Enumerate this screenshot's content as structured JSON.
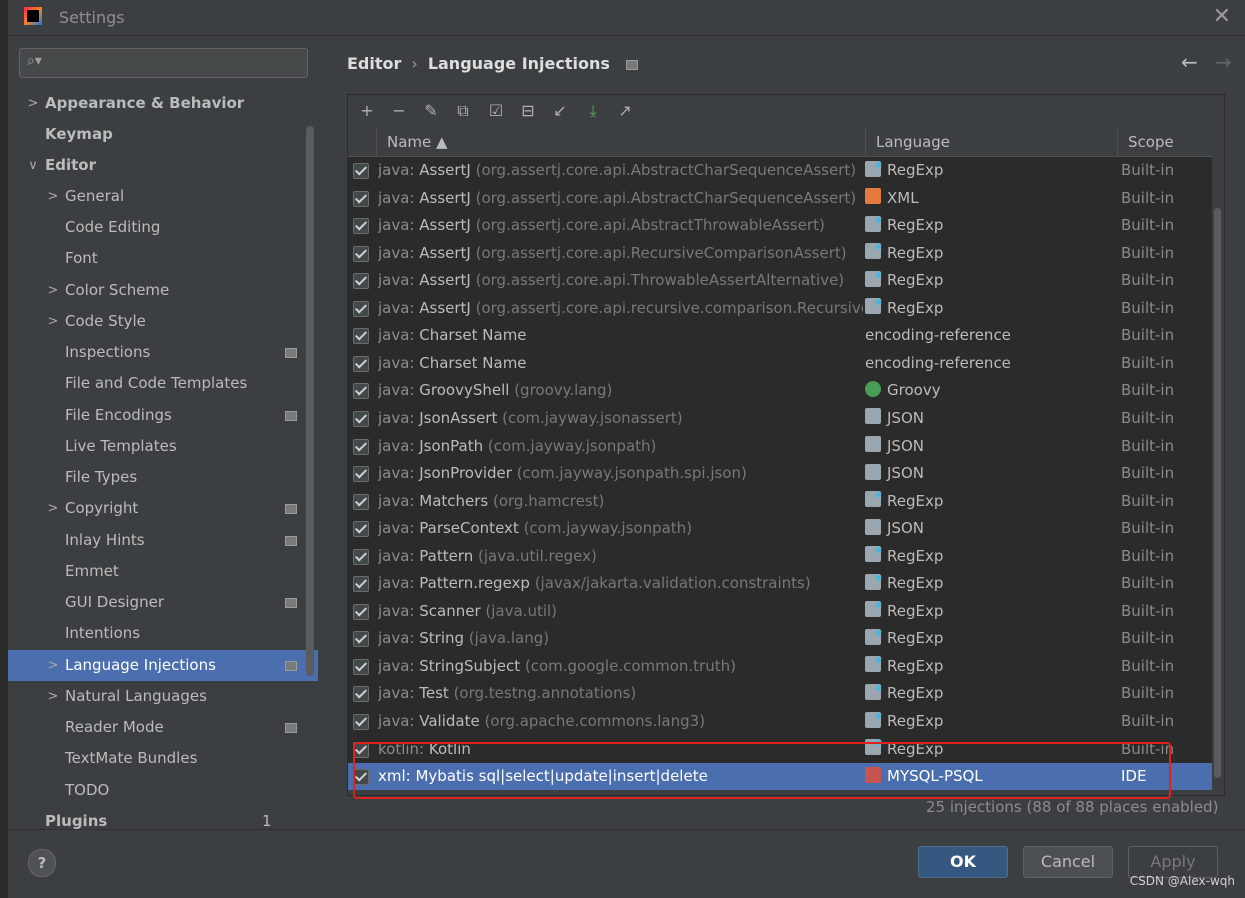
{
  "window": {
    "title": "Settings"
  },
  "search": {
    "placeholder": ""
  },
  "sidebar": {
    "items": [
      {
        "label": "Appearance & Behavior",
        "arrow": ">",
        "bold": true
      },
      {
        "label": "Keymap",
        "bold": true
      },
      {
        "label": "Editor",
        "arrow": "∨",
        "bold": true
      },
      {
        "label": "General",
        "arrow": ">"
      },
      {
        "label": "Code Editing"
      },
      {
        "label": "Font"
      },
      {
        "label": "Color Scheme",
        "arrow": ">"
      },
      {
        "label": "Code Style",
        "arrow": ">"
      },
      {
        "label": "Inspections",
        "proj": true
      },
      {
        "label": "File and Code Templates"
      },
      {
        "label": "File Encodings",
        "proj": true
      },
      {
        "label": "Live Templates"
      },
      {
        "label": "File Types"
      },
      {
        "label": "Copyright",
        "arrow": ">",
        "proj": true
      },
      {
        "label": "Inlay Hints",
        "proj": true
      },
      {
        "label": "Emmet"
      },
      {
        "label": "GUI Designer",
        "proj": true
      },
      {
        "label": "Intentions"
      },
      {
        "label": "Language Injections",
        "arrow": ">",
        "proj": true,
        "selected": true
      },
      {
        "label": "Natural Languages",
        "arrow": ">"
      },
      {
        "label": "Reader Mode",
        "proj": true
      },
      {
        "label": "TextMate Bundles"
      },
      {
        "label": "TODO"
      },
      {
        "label": "Plugins",
        "bold": true,
        "count": "1"
      }
    ]
  },
  "breadcrumb": {
    "parent": "Editor",
    "separator": "›",
    "current": "Language Injections"
  },
  "nav": {
    "back": "←",
    "forward": "→"
  },
  "toolbar": {
    "icons": [
      "add-icon",
      "remove-icon",
      "edit-icon",
      "copy-icon",
      "enable-icon",
      "disable-icon",
      "import-icon",
      "download-icon",
      "export-icon"
    ],
    "glyphs": [
      "+",
      "−",
      "✎",
      "⧉",
      "☑",
      "⊟",
      "↙",
      "⤓",
      "↗"
    ]
  },
  "table": {
    "headers": {
      "name": "Name ▲",
      "language": "Language",
      "scope": "Scope"
    },
    "rows": [
      {
        "pfx": "java: ",
        "id": "AssertJ",
        "pkg": " (org.assertj.core.api.AbstractCharSequenceAssert)",
        "lang": "RegExp",
        "icon": "regexp",
        "scope": "Built-in"
      },
      {
        "pfx": "java: ",
        "id": "AssertJ",
        "pkg": " (org.assertj.core.api.AbstractCharSequenceAssert)",
        "lang": "XML",
        "icon": "xml",
        "scope": "Built-in"
      },
      {
        "pfx": "java: ",
        "id": "AssertJ",
        "pkg": " (org.assertj.core.api.AbstractThrowableAssert)",
        "lang": "RegExp",
        "icon": "regexp",
        "scope": "Built-in"
      },
      {
        "pfx": "java: ",
        "id": "AssertJ",
        "pkg": " (org.assertj.core.api.RecursiveComparisonAssert)",
        "lang": "RegExp",
        "icon": "regexp",
        "scope": "Built-in"
      },
      {
        "pfx": "java: ",
        "id": "AssertJ",
        "pkg": " (org.assertj.core.api.ThrowableAssertAlternative)",
        "lang": "RegExp",
        "icon": "regexp",
        "scope": "Built-in"
      },
      {
        "pfx": "java: ",
        "id": "AssertJ",
        "pkg": " (org.assertj.core.api.recursive.comparison.RecursiveCo",
        "lang": "RegExp",
        "icon": "regexp",
        "scope": "Built-in"
      },
      {
        "pfx": "java: ",
        "id": "Charset Name",
        "pkg": "",
        "lang": "encoding-reference",
        "icon": "",
        "scope": "Built-in"
      },
      {
        "pfx": "java: ",
        "id": "Charset Name",
        "pkg": "",
        "lang": "encoding-reference",
        "icon": "",
        "scope": "Built-in"
      },
      {
        "pfx": "java: ",
        "id": "GroovyShell",
        "pkg": " (groovy.lang)",
        "lang": "Groovy",
        "icon": "groovy",
        "scope": "Built-in"
      },
      {
        "pfx": "java: ",
        "id": "JsonAssert",
        "pkg": " (com.jayway.jsonassert)",
        "lang": "JSON",
        "icon": "json",
        "scope": "Built-in"
      },
      {
        "pfx": "java: ",
        "id": "JsonPath",
        "pkg": " (com.jayway.jsonpath)",
        "lang": "JSON",
        "icon": "json",
        "scope": "Built-in"
      },
      {
        "pfx": "java: ",
        "id": "JsonProvider",
        "pkg": " (com.jayway.jsonpath.spi.json)",
        "lang": "JSON",
        "icon": "json",
        "scope": "Built-in"
      },
      {
        "pfx": "java: ",
        "id": "Matchers",
        "pkg": " (org.hamcrest)",
        "lang": "RegExp",
        "icon": "regexp",
        "scope": "Built-in"
      },
      {
        "pfx": "java: ",
        "id": "ParseContext",
        "pkg": " (com.jayway.jsonpath)",
        "lang": "JSON",
        "icon": "json",
        "scope": "Built-in"
      },
      {
        "pfx": "java: ",
        "id": "Pattern",
        "pkg": " (java.util.regex)",
        "lang": "RegExp",
        "icon": "regexp",
        "scope": "Built-in"
      },
      {
        "pfx": "java: ",
        "id": "Pattern.regexp",
        "pkg": " (javax/jakarta.validation.constraints)",
        "lang": "RegExp",
        "icon": "regexp",
        "scope": "Built-in"
      },
      {
        "pfx": "java: ",
        "id": "Scanner",
        "pkg": " (java.util)",
        "lang": "RegExp",
        "icon": "regexp",
        "scope": "Built-in"
      },
      {
        "pfx": "java: ",
        "id": "String",
        "pkg": " (java.lang)",
        "lang": "RegExp",
        "icon": "regexp",
        "scope": "Built-in"
      },
      {
        "pfx": "java: ",
        "id": "StringSubject",
        "pkg": " (com.google.common.truth)",
        "lang": "RegExp",
        "icon": "regexp",
        "scope": "Built-in"
      },
      {
        "pfx": "java: ",
        "id": "Test",
        "pkg": " (org.testng.annotations)",
        "lang": "RegExp",
        "icon": "regexp",
        "scope": "Built-in"
      },
      {
        "pfx": "java: ",
        "id": "Validate",
        "pkg": " (org.apache.commons.lang3)",
        "lang": "RegExp",
        "icon": "regexp",
        "scope": "Built-in"
      },
      {
        "pfx": "kotlin: ",
        "id": "Kotlin",
        "pkg": "",
        "lang": "RegExp",
        "icon": "regexp",
        "scope": "Built-in"
      },
      {
        "pfx": "xml: ",
        "id": "Mybatis sql|select|update|insert|delete",
        "pkg": "",
        "lang": "MYSQL-PSQL",
        "icon": "sql",
        "scope": "IDE",
        "selected": true
      }
    ]
  },
  "status": "25 injections (88 of 88 places enabled)",
  "footer": {
    "help": "?",
    "ok": "OK",
    "cancel": "Cancel",
    "apply": "Apply"
  },
  "watermark": "CSDN @Alex-wqh",
  "colors": {
    "selection": "#4b6eaf",
    "highlight_box": "#e0221c",
    "ok_button": "#365880"
  }
}
